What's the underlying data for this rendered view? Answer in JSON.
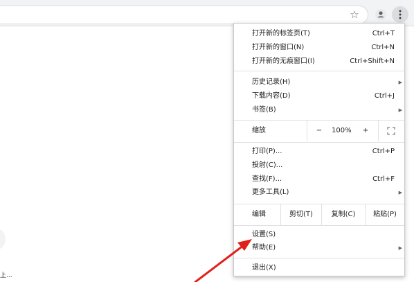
{
  "colors": {
    "toolbar_bg": "#f1f3f4",
    "menu_border": "#c8c8c8",
    "arrow": "#e0211a",
    "menu_btn_bg": "#dadce0"
  },
  "toolbar": {
    "star_icon": "star-icon",
    "profile_icon": "person-icon",
    "menu_icon": "three-dots-vertical-icon"
  },
  "page": {
    "bottom_text": "上..."
  },
  "menu": {
    "new_tab": {
      "label": "打开新的标签页(T)",
      "shortcut": "Ctrl+T"
    },
    "new_window": {
      "label": "打开新的窗口(N)",
      "shortcut": "Ctrl+N"
    },
    "new_incognito": {
      "label": "打开新的无痕窗口(I)",
      "shortcut": "Ctrl+Shift+N"
    },
    "history": {
      "label": "历史记录(H)"
    },
    "downloads": {
      "label": "下载内容(D)",
      "shortcut": "Ctrl+J"
    },
    "bookmarks": {
      "label": "书签(B)"
    },
    "zoom": {
      "label": "缩放",
      "minus": "−",
      "value": "100%",
      "plus": "+"
    },
    "print": {
      "label": "打印(P)...",
      "shortcut": "Ctrl+P"
    },
    "cast": {
      "label": "投射(C)..."
    },
    "find": {
      "label": "查找(F)...",
      "shortcut": "Ctrl+F"
    },
    "more_tools": {
      "label": "更多工具(L)"
    },
    "edit": {
      "label": "编辑",
      "cut": "剪切(T)",
      "copy": "复制(C)",
      "paste": "粘贴(P)"
    },
    "settings": {
      "label": "设置(S)"
    },
    "help": {
      "label": "帮助(E)"
    },
    "exit": {
      "label": "退出(X)"
    }
  }
}
